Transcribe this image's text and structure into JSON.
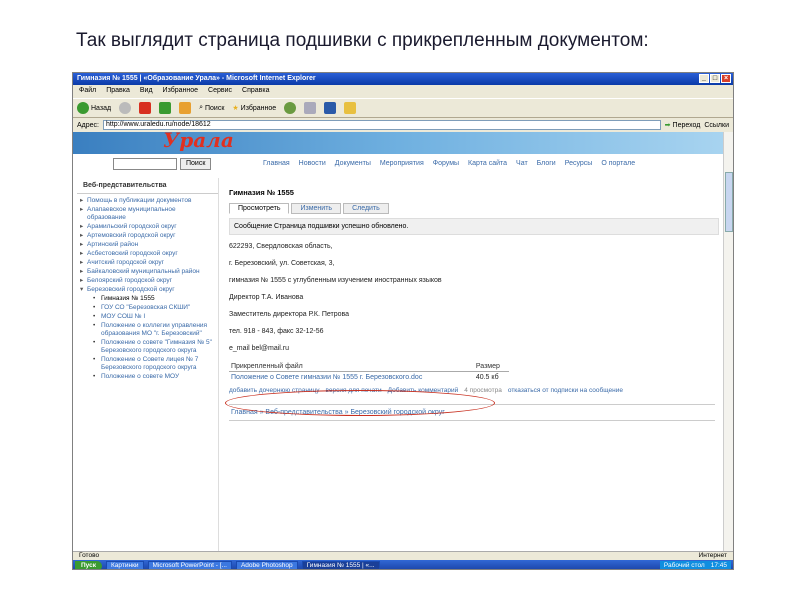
{
  "slide_title": "Так выглядит страница подшивки с прикрепленным документом:",
  "window": {
    "title": "Гимназия № 1555 | «Образование Урала» - Microsoft Internet Explorer",
    "menu": [
      "Файл",
      "Правка",
      "Вид",
      "Избранное",
      "Сервис",
      "Справка"
    ],
    "toolbar": {
      "back": "Назад",
      "search": "Поиск",
      "favorites": "Избранное"
    },
    "address_label": "Адрес:",
    "address_value": "http://www.uraledu.ru/node/18612",
    "go_label": "Переход",
    "links_label": "Ссылки"
  },
  "site": {
    "logo": "Урала",
    "search_button": "Поиск",
    "nav": [
      "Главная",
      "Новости",
      "Документы",
      "Мероприятия",
      "Форумы",
      "Карта сайта",
      "Чат",
      "Блоги",
      "Ресурсы",
      "О портале"
    ]
  },
  "sidebar": {
    "heading": "Веб-представительства",
    "items": [
      "Помощь в публикации документов",
      "Алапаевское муниципальное образование",
      "Арамильский городской округ",
      "Артемовский городской округ",
      "Артинский район",
      "Асбестовский городской округ",
      "Ачитский городской округ",
      "Байкаловский муниципальный район",
      "Белоярский городской округ",
      "Березовский городской округ"
    ],
    "sub_items": [
      "Гимназия № 1555",
      "ГОУ СО \"Березовская СКШИ\"",
      "МОУ СОШ № I",
      "Положение о коллегии управления образования МО \"г. Березовский\"",
      "Положение о совете \"Гимназия № 5\" Березовского городского округа",
      "Положение о Совете лицея № 7 Березовского городского округа",
      "Положение о совете МОУ"
    ]
  },
  "content": {
    "title": "Гимназия № 1555",
    "tabs": [
      "Просмотреть",
      "Изменить",
      "Следить"
    ],
    "message": "Сообщение Страница подшивки успешно обновлено.",
    "lines": [
      "622293, Свердловская область,",
      "г. Березовский, ул. Советская, 3,",
      "гимназия № 1555 с углубленным изучением иностранных языков",
      "Директор Т.А. Иванова",
      "Заместитель директора Р.К. Петрова",
      "тел. 918 - 843, факс 32-12-56",
      "e_mail bel@mail.ru"
    ],
    "file_header": {
      "file": "Прикрепленный файл",
      "size": "Размер"
    },
    "file": {
      "name": "Положение о Совете гимназии № 1555 г. Березовского.doc",
      "size": "40.5 кб"
    },
    "links": [
      "добавить дочернюю страницу",
      "версия для печати",
      "Добавить комментарий",
      "4 просмотра",
      "отказаться от подписки на сообщение"
    ],
    "breadcrumbs": "Главная » Веб-представительства » Березовский городской округ"
  },
  "statusbar": {
    "left": "Готово",
    "right": "Интернет"
  },
  "taskbar": {
    "start": "Пуск",
    "tasks": [
      "Картинки",
      "Microsoft PowerPoint - [...",
      "Adobe Photoshop",
      "Гимназия № 1555 | «..."
    ],
    "tray": [
      "Рабочий стол",
      "17:45"
    ]
  }
}
